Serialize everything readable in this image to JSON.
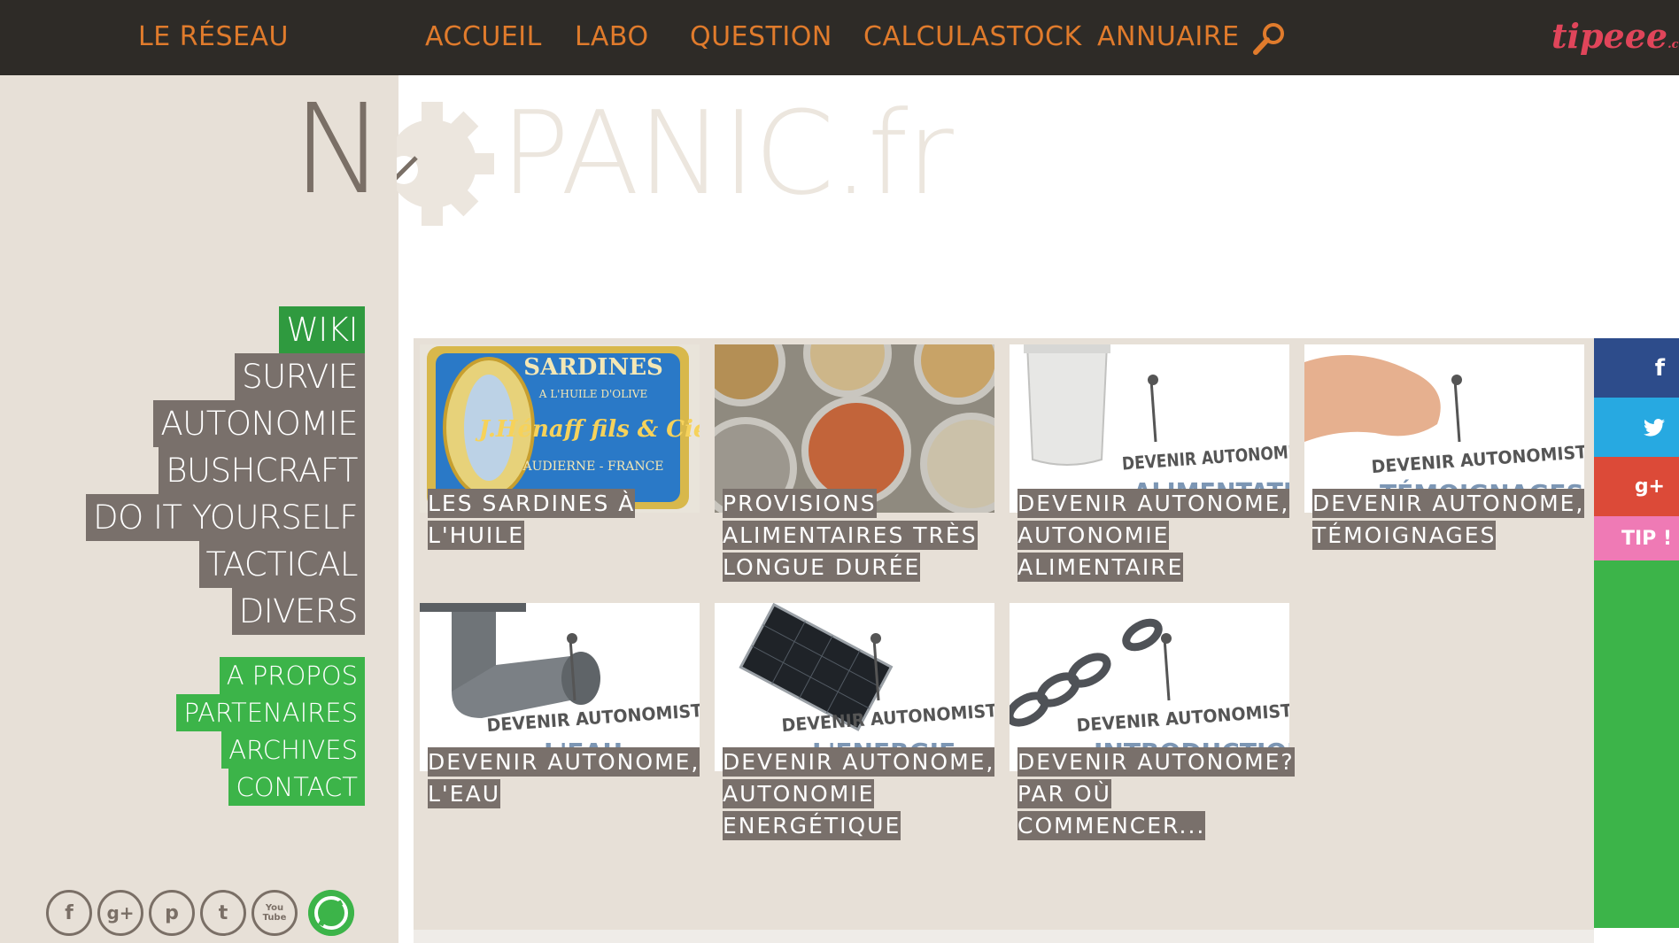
{
  "topnav": {
    "reseau": "LE RÉSEAU",
    "items": [
      "ACCUEIL",
      "LABO",
      "QUESTION",
      "CALCULASTOCK",
      "ANNUAIRE"
    ],
    "tipeee_label": "tipeee",
    "tipeee_domain": ".com"
  },
  "logo": {
    "left": "N",
    "right": "PANIC.fr"
  },
  "categories": [
    "WIKI",
    "SURVIE",
    "AUTONOMIE",
    "BUSHCRAFT",
    "DO IT YOURSELF",
    "TACTICAL",
    "DIVERS"
  ],
  "pages": [
    "A PROPOS",
    "PARTENAIRES",
    "ARCHIVES",
    "CONTACT"
  ],
  "social": [
    "f",
    "g+",
    "p",
    "t",
    "You Tube"
  ],
  "cards": [
    {
      "title": "LES SARDINES À L'HUILE",
      "thumb_text": [
        "SARDINES",
        "A L'HUILE D'OLIVE",
        "J.Hénaff fils & Cie",
        "AUDIERNE - FRANCE"
      ]
    },
    {
      "title": "PROVISIONS ALIMENTAIRES TRÈS LONGUE DURÉE",
      "thumb_text": []
    },
    {
      "title": "DEVENIR AUTONOME, AUTONOMIE ALIMENTAIRE",
      "thumb_text": [
        "DEVENIR AUTONOMISTE",
        "ALIMENTATION"
      ]
    },
    {
      "title": "DEVENIR AUTONOME, TÉMOIGNAGES",
      "thumb_text": [
        "DEVENIR AUTONOMISTE",
        "TÉMOIGNAGES"
      ]
    },
    {
      "title": "DEVENIR AUTONOME, L'EAU",
      "thumb_text": [
        "DEVENIR AUTONOMISTE",
        "L'EAU"
      ]
    },
    {
      "title": "DEVENIR AUTONOME, AUTONOMIE ENERGÉTIQUE",
      "thumb_text": [
        "DEVENIR AUTONOMISTE",
        "L'ENERGIE"
      ]
    },
    {
      "title": "DEVENIR AUTONOME? PAR OÙ COMMENCER...",
      "thumb_text": [
        "DEVENIR AUTONOMISTE",
        "INTRODUCTION"
      ]
    }
  ],
  "share": {
    "facebook": "f",
    "twitter": "t",
    "gplus": "g+",
    "tip": "TIP !"
  },
  "colors": {
    "topbar": "#2e2b27",
    "nav_text": "#e07b2c",
    "sidebar": "#e7e0d7",
    "category": "#79706b",
    "active": "#2f9a3f",
    "page_link": "#3cb449",
    "facebook": "#2d4c8b",
    "twitter": "#27a9e1",
    "gplus": "#dc4a38",
    "tip": "#ef7ab5"
  }
}
